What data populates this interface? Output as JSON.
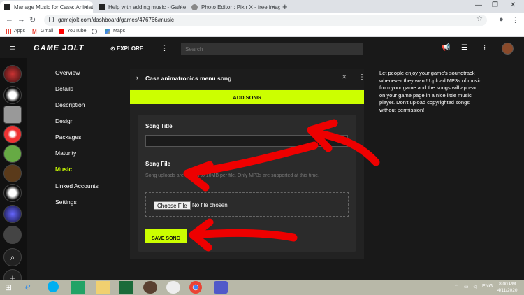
{
  "browser": {
    "tabs": [
      {
        "title": "Manage Music for Case: Animatro",
        "active": true
      },
      {
        "title": "Help with adding music - Game",
        "active": false
      },
      {
        "title": "Photo Editor : Pixlr X - free image",
        "active": false
      }
    ],
    "new_tab": "+",
    "url": "gamejolt.com/dashboard/games/476766/music",
    "bookmarks": [
      "Apps",
      "Gmail",
      "YouTube",
      "Maps"
    ]
  },
  "site": {
    "logo": "GAME JOLT",
    "explore": "EXPLORE",
    "search_placeholder": "Search"
  },
  "nav": {
    "items": [
      "Overview",
      "Details",
      "Description",
      "Design",
      "Packages",
      "Maturity",
      "Music",
      "Linked Accounts",
      "Settings"
    ],
    "active": "Music"
  },
  "card": {
    "song_name": "Case animatronics menu song",
    "add_song": "ADD SONG",
    "song_title_label": "Song Title",
    "song_file_label": "Song File",
    "file_hint": "Song uploads are limited to 10MB per file. Only MP3s are supported at this time.",
    "choose_file": "Choose File",
    "no_file": "No file chosen",
    "save": "SAVE SONG"
  },
  "info_text": "Let people enjoy your game's soundtrack whenever they want! Upload MP3s of music from your game and the songs will appear on your game page in a nice little music player. Don't upload copyrighted songs without permission!",
  "taskbar": {
    "lang": "ENG",
    "time": "8:00 PM",
    "date": "4/11/2020"
  },
  "colors": {
    "accent": "#ccff00",
    "annotation": "#ee0000"
  }
}
